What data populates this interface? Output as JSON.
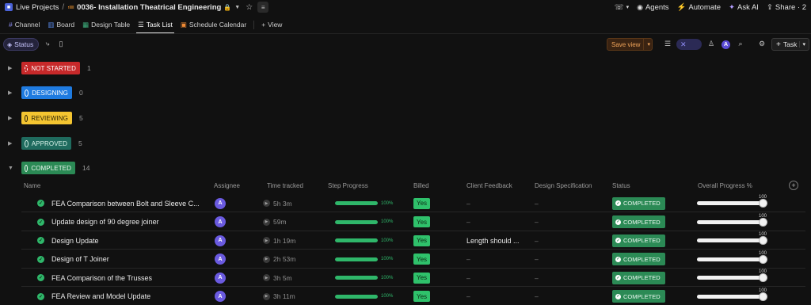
{
  "topbar": {
    "space": "Live Projects",
    "project": "0036- Installation Theatrical Engineering",
    "agents": "Agents",
    "automate": "Automate",
    "ask_ai": "Ask AI",
    "share": "Share · 2"
  },
  "tabs": [
    {
      "label": "Channel"
    },
    {
      "label": "Board"
    },
    {
      "label": "Design Table"
    },
    {
      "label": "Task List"
    },
    {
      "label": "Schedule Calendar"
    },
    {
      "label": "View"
    }
  ],
  "toolbar": {
    "status_chip": "Status",
    "save_view": "Save view",
    "avatar_letter": "A",
    "task_button": "Task"
  },
  "groups": [
    {
      "label": "NOT STARTED",
      "count": "1",
      "bg": "#c7292a",
      "fg": "#ffffff"
    },
    {
      "label": "DESIGNING",
      "count": "0",
      "bg": "#1f7be0",
      "fg": "#ffffff"
    },
    {
      "label": "REVIEWING",
      "count": "5",
      "bg": "#f4c531",
      "fg": "#2b2205"
    },
    {
      "label": "APPROVED",
      "count": "5",
      "bg": "#1f6b5e",
      "fg": "#d9f3ea"
    },
    {
      "label": "COMPLETED",
      "count": "14",
      "bg": "#2b8a55",
      "fg": "#eaf7ef"
    }
  ],
  "columns": {
    "name": "Name",
    "assignee": "Assignee",
    "time_tracked": "Time tracked",
    "step_progress": "Step Progress",
    "billed": "Billed",
    "client_feedback": "Client Feedback",
    "design_spec": "Design Specification",
    "status": "Status",
    "overall_progress": "Overall Progress %"
  },
  "rows": [
    {
      "name": "FEA Comparison between Bolt and Sleeve C...",
      "assignee": "A",
      "time": "5h 3m",
      "progress": 1.0,
      "progress_label": "100%",
      "billed": "Yes",
      "feedback": "–",
      "spec": "–",
      "status": "COMPLETED",
      "overall": 100,
      "overall_label": "100"
    },
    {
      "name": "Update design of 90 degree joiner",
      "assignee": "A",
      "time": "59m",
      "progress": 1.0,
      "progress_label": "100%",
      "billed": "Yes",
      "feedback": "–",
      "spec": "–",
      "status": "COMPLETED",
      "overall": 100,
      "overall_label": "100"
    },
    {
      "name": "Design Update",
      "assignee": "A",
      "time": "1h 19m",
      "progress": 1.0,
      "progress_label": "100%",
      "billed": "Yes",
      "feedback": "Length should ...",
      "spec": "–",
      "status": "COMPLETED",
      "overall": 100,
      "overall_label": "100"
    },
    {
      "name": "Design of T Joiner",
      "assignee": "A",
      "time": "2h 53m",
      "progress": 1.0,
      "progress_label": "100%",
      "billed": "Yes",
      "feedback": "–",
      "spec": "–",
      "status": "COMPLETED",
      "overall": 100,
      "overall_label": "100"
    },
    {
      "name": "FEA Comparison of the Trusses",
      "assignee": "A",
      "time": "3h 5m",
      "progress": 1.0,
      "progress_label": "100%",
      "billed": "Yes",
      "feedback": "–",
      "spec": "–",
      "status": "COMPLETED",
      "overall": 100,
      "overall_label": "100"
    },
    {
      "name": "FEA Review and Model Update",
      "assignee": "A",
      "time": "3h 11m",
      "progress": 1.0,
      "progress_label": "100%",
      "billed": "Yes",
      "feedback": "–",
      "spec": "–",
      "status": "COMPLETED",
      "overall": 100,
      "overall_label": "100"
    }
  ]
}
